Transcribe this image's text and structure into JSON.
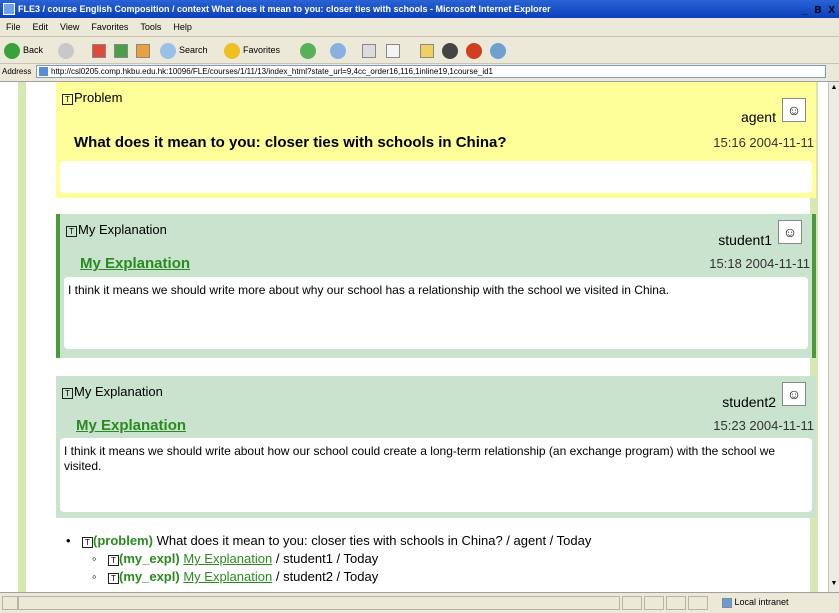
{
  "window": {
    "title": "FLE3 / course English Composition / context What does it mean to you: closer ties with schools - Microsoft Internet Explorer",
    "controls": "_ B X"
  },
  "menu": [
    "File",
    "Edit",
    "View",
    "Favorites",
    "Tools",
    "Help"
  ],
  "toolbar": {
    "back_label": "Back",
    "search_label": "Search",
    "favorites_label": "Favorites"
  },
  "address": {
    "label": "Address",
    "url": "http://csl0205.comp.hkbu.edu.hk:10096/FLE/courses/1/11/13/index_html?state_url=9,4cc_order16,116,1inline19,1course_id1"
  },
  "problem": {
    "type_label": "Problem",
    "author": "agent",
    "title": "What does it mean to you: closer ties with schools in China?",
    "date": "15:16 2004-11-11",
    "body": ""
  },
  "explanations": [
    {
      "type_label": "My Explanation",
      "author": "student1",
      "title": "My Explanation",
      "date": "15:18 2004-11-11",
      "body": "I think it means we should write more about why our school has a relationship with the school we visited in China."
    },
    {
      "type_label": "My Explanation",
      "author": "student2",
      "title": "My Explanation",
      "date": "15:23 2004-11-11",
      "body": "I think it means we should write about how our school could create a long-term relationship (an exchange program) with the school we visited."
    }
  ],
  "tree": {
    "root": {
      "tag": "(problem)",
      "text": "What does it mean to you: closer ties with schools in China? / agent / Today"
    },
    "children": [
      {
        "tag": "(my_expl)",
        "link": "My Explanation",
        "meta": "/ student1 / Today"
      },
      {
        "tag": "(my_expl)",
        "link": "My Explanation",
        "meta": "/ student2 / Today"
      }
    ]
  },
  "status": {
    "zone": "Local intranet"
  }
}
